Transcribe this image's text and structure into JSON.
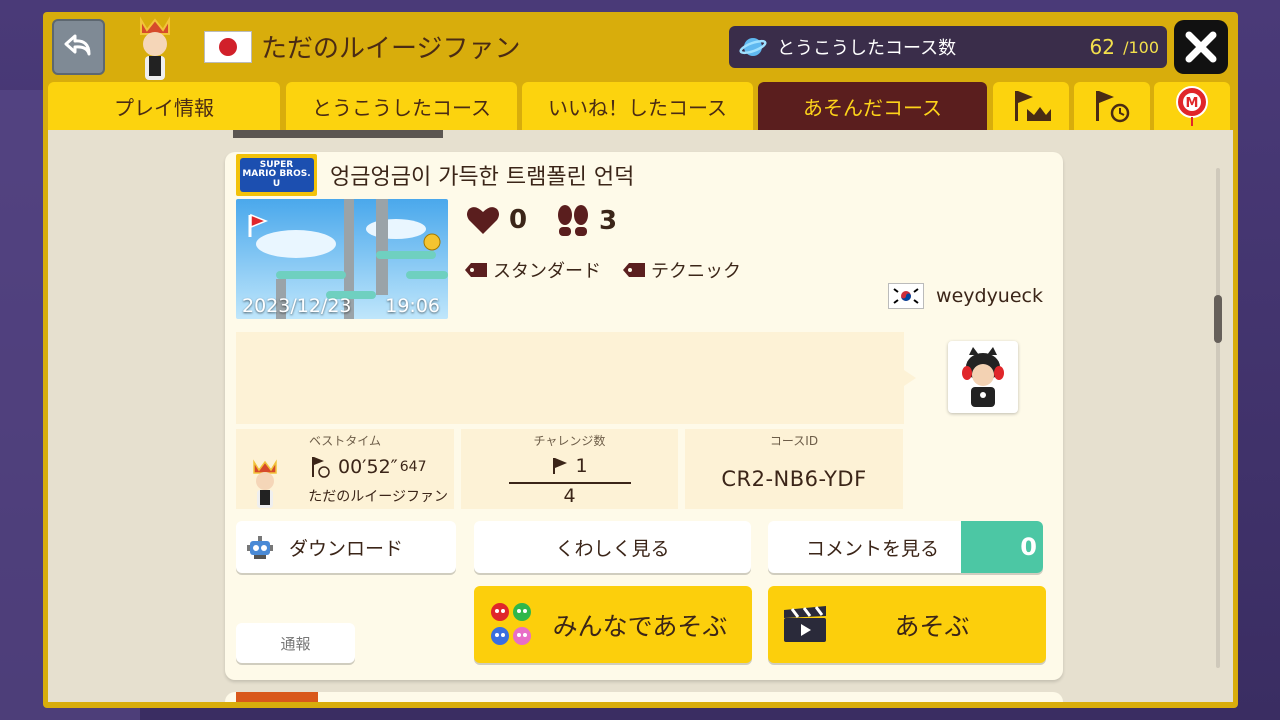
{
  "header": {
    "player_name": "ただのルイージファン",
    "uploaded_label": "とうこうしたコース数",
    "uploaded_count": "62",
    "uploaded_max": "/100"
  },
  "tabs": [
    {
      "label": "プレイ情報",
      "active": false
    },
    {
      "label": "とうこうしたコース",
      "active": false
    },
    {
      "label": "いいね！したコース",
      "active": false
    },
    {
      "label": "あそんだコース",
      "active": true
    },
    {
      "icon": "flag-crown-icon"
    },
    {
      "icon": "flag-clock-icon"
    },
    {
      "icon": "mario-balloon-icon"
    }
  ],
  "course": {
    "game_style": "SUPER MARIO BROS. U",
    "title": "엉금엉금이 가득한 트램폴린 언덕",
    "date": "2023/12/23",
    "time": "19:06",
    "likes": "0",
    "plays": "3",
    "tags": [
      "スタンダード",
      "テクニック"
    ],
    "creator": "weydyueck",
    "best_time_label": "ベストタイム",
    "best_time_main": "00′52″",
    "best_time_ms": "647",
    "best_time_holder": "ただのルイージファン",
    "challenge_label": "チャレンジ数",
    "clears": "1",
    "attempts": "4",
    "course_id_label": "コースID",
    "course_id": "CR2-NB6-YDF"
  },
  "buttons": {
    "download": "ダウンロード",
    "details": "くわしく見る",
    "comments": "コメントを見る",
    "comment_count": "0",
    "report": "通報",
    "multiplayer": "みんなであそぶ",
    "play": "あそぶ"
  },
  "colors": {
    "frame": "#d8ad0c",
    "tab": "#fcd30e",
    "tab_active": "#5a1e1e",
    "accent_green": "#4cc7a4"
  }
}
